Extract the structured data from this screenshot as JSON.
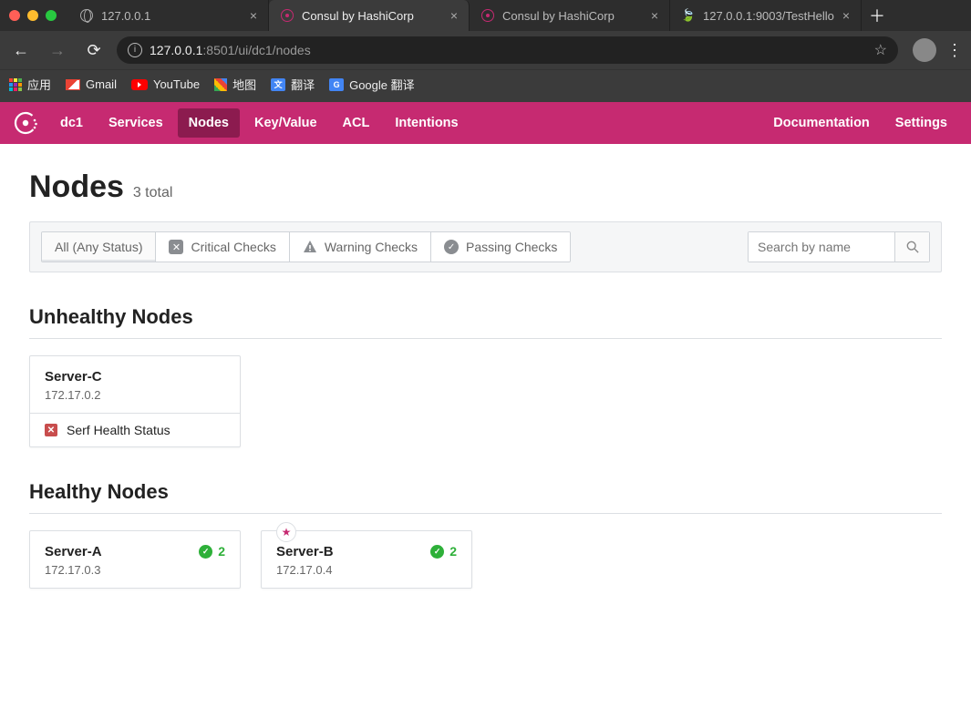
{
  "browser": {
    "tabs": [
      {
        "title": "127.0.0.1",
        "icon": "globe"
      },
      {
        "title": "Consul by HashiCorp",
        "icon": "consul",
        "active": true
      },
      {
        "title": "Consul by HashiCorp",
        "icon": "consul"
      },
      {
        "title": "127.0.0.1:9003/TestHello",
        "icon": "leaf"
      }
    ],
    "url_host": "127.0.0.1",
    "url_rest": ":8501/ui/dc1/nodes",
    "bookmarks": {
      "apps": "应用",
      "gmail": "Gmail",
      "youtube": "YouTube",
      "maps": "地图",
      "translate": "翻译",
      "gtranslate": "Google 翻译"
    }
  },
  "nav": {
    "dc": "dc1",
    "items": [
      "Services",
      "Nodes",
      "Key/Value",
      "ACL",
      "Intentions"
    ],
    "active": "Nodes",
    "right": [
      "Documentation",
      "Settings"
    ]
  },
  "page": {
    "title": "Nodes",
    "total": "3 total",
    "filters": {
      "all": "All (Any Status)",
      "critical": "Critical Checks",
      "warning": "Warning Checks",
      "passing": "Passing Checks"
    },
    "search_placeholder": "Search by name",
    "sections": {
      "unhealthy": "Unhealthy Nodes",
      "healthy": "Healthy Nodes"
    },
    "unhealthy": [
      {
        "name": "Server-C",
        "ip": "172.17.0.2",
        "check": "Serf Health Status"
      }
    ],
    "healthy": [
      {
        "name": "Server-A",
        "ip": "172.17.0.3",
        "passing": "2",
        "leader": false
      },
      {
        "name": "Server-B",
        "ip": "172.17.0.4",
        "passing": "2",
        "leader": true
      }
    ]
  }
}
